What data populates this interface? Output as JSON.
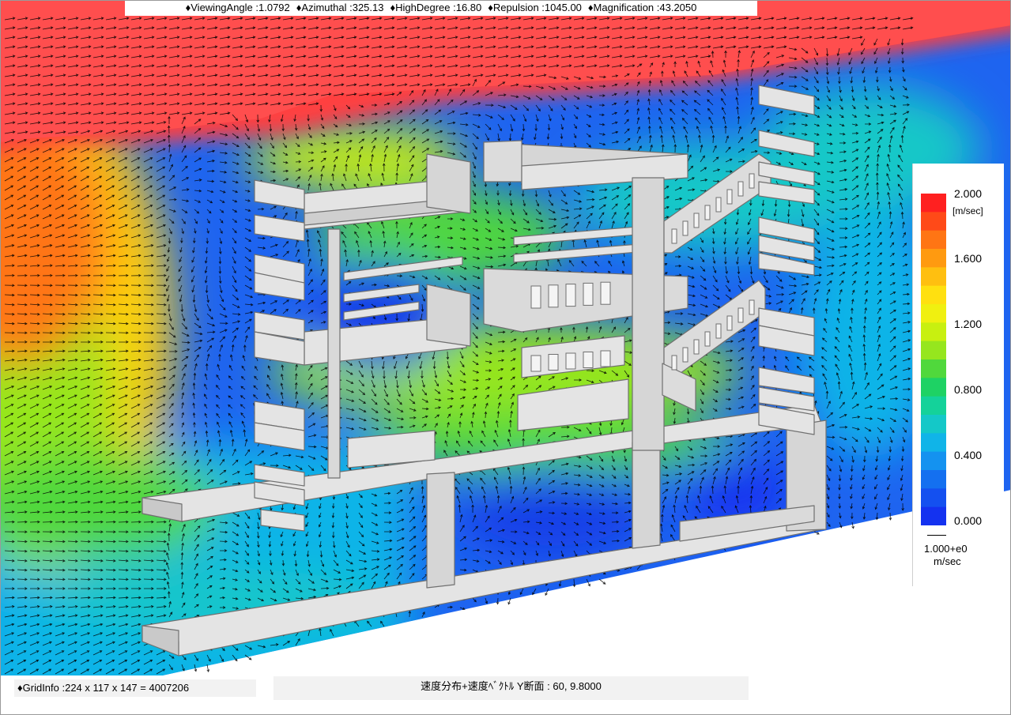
{
  "header": {
    "items": [
      "♦ViewingAngle :1.0792",
      "♦Azimuthal :325.13",
      "♦HighDegree :16.80",
      "♦Repulsion :1045.00",
      "♦Magnification :43.2050"
    ]
  },
  "legend": {
    "labels": [
      "2.000",
      "1.600",
      "1.200",
      "0.800",
      "0.400",
      "0.000"
    ],
    "unit": "[m/sec]",
    "reference_value": "1.000+e0",
    "reference_unit": "m/sec",
    "colors": [
      "#ff2020",
      "#ff4a18",
      "#ff7514",
      "#ff9a10",
      "#ffbf10",
      "#ffe010",
      "#f0f010",
      "#c8f010",
      "#96e61e",
      "#50d83c",
      "#1ed264",
      "#14d29a",
      "#14c8c8",
      "#10b4e8",
      "#1492f0",
      "#1470f0",
      "#1450f0",
      "#1432f0"
    ]
  },
  "footer": {
    "grid_info": "♦GridInfo :224 x 117 x 147 = 4007206",
    "section": "速度分布+速度ﾍﾞｸﾄﾙ Y断面 : 60,  9.8000"
  }
}
